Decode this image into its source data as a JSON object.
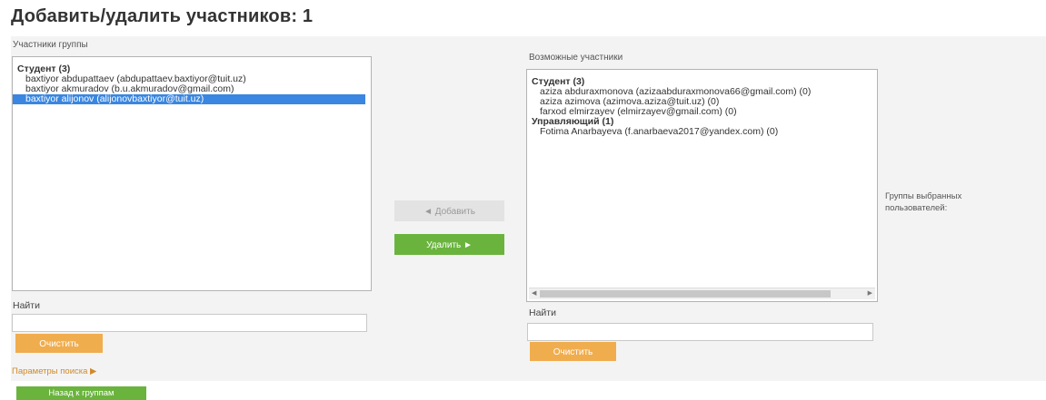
{
  "page_title": "Добавить/удалить участников: 1",
  "group_members": {
    "label": "Участники группы",
    "groups": [
      {
        "heading": "Студент (3)",
        "items": [
          "baxtiyor abdupattaev (abdupattaev.baxtiyor@tuit.uz)",
          "baxtiyor akmuradov (b.u.akmuradov@gmail.com)",
          "baxtiyor alijonov (alijonovbaxtiyor@tuit.uz)"
        ]
      }
    ],
    "selected": "baxtiyor alijonov (alijonovbaxtiyor@tuit.uz)",
    "find_label": "Найти",
    "find_value": "",
    "clear_label": "Очистить"
  },
  "potential_members": {
    "label": "Возможные участники",
    "groups": [
      {
        "heading": "Студент (3)",
        "items": [
          "aziza abduraxmonova (azizaabduraxmonova66@gmail.com) (0)",
          "aziza azimova (azimova.aziza@tuit.uz) (0)",
          "farxod elmirzayev (elmirzayev@gmail.com) (0)"
        ]
      },
      {
        "heading": "Управляющий (1)",
        "items": [
          "Fotima Anarbayeva (f.anarbaeva2017@yandex.com) (0)"
        ]
      }
    ],
    "find_label": "Найти",
    "find_value": "",
    "clear_label": "Очистить"
  },
  "actions": {
    "add_label": "◄ Добавить",
    "remove_label": "Удалить ►"
  },
  "side_note": "Группы выбранных пользователей:",
  "search_params": "Параметры поиска ▶",
  "back_label": "Назад к группам",
  "colors": {
    "accent_green": "#6ab43e",
    "accent_orange": "#f0ad4e",
    "selection_blue": "#3a86e0",
    "panel_bg": "#f3f3f3"
  }
}
